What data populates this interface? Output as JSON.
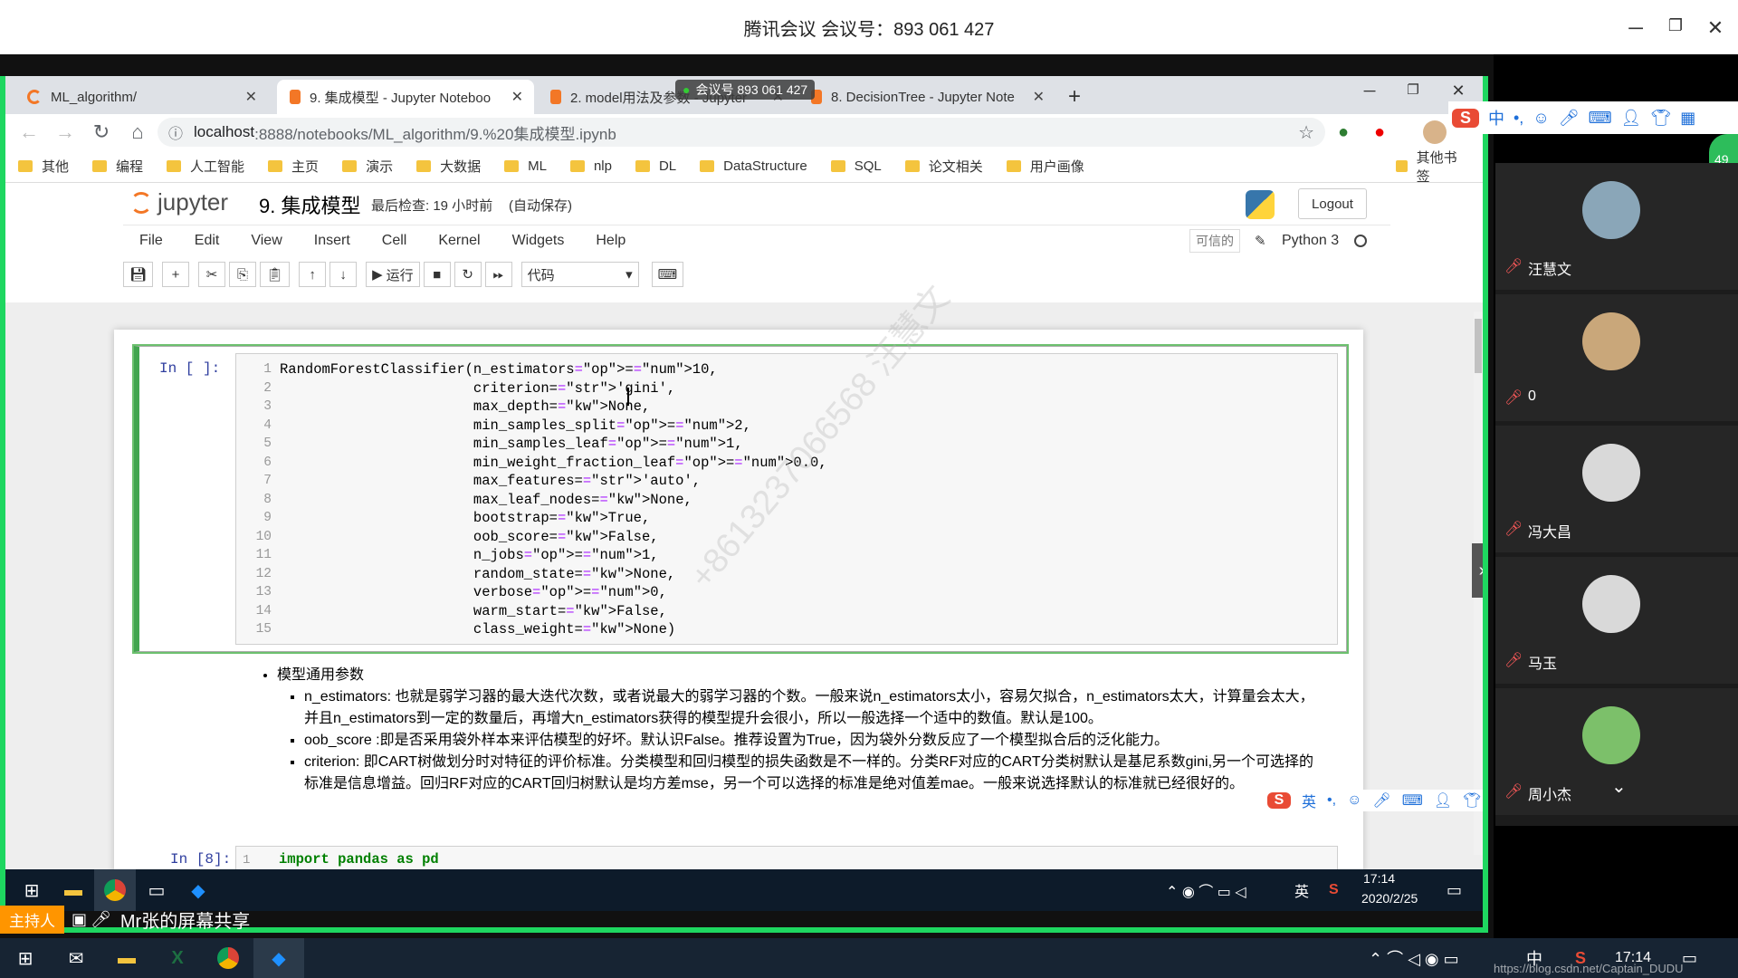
{
  "meeting": {
    "title": "腾讯会议 会议号：893 061 427",
    "float_label": "会议号 893 061 427"
  },
  "browser": {
    "tabs": [
      {
        "label": "ML_algorithm/",
        "active": false
      },
      {
        "label": "9. 集成模型 - Jupyter Noteboo",
        "active": true
      },
      {
        "label": "2. model用法及参数 - Jupyter",
        "active": false
      },
      {
        "label": "8. DecisionTree - Jupyter Note",
        "active": false
      }
    ],
    "url_host": "localhost",
    "url_path": ":8888/notebooks/ML_algorithm/9.%20集成模型.ipynb",
    "bookmarks": [
      "其他",
      "编程",
      "人工智能",
      "主页",
      "演示",
      "大数据",
      "ML",
      "nlp",
      "DL",
      "DataStructure",
      "SQL",
      "论文相关",
      "用户画像"
    ],
    "other_bookmarks": "其他书签"
  },
  "jupyter": {
    "logo_text": "jupyter",
    "notebook_name": "9. 集成模型",
    "checkpoint": "最后检查: 19 小时前",
    "autosave": "(自动保存)",
    "logout": "Logout",
    "menu": [
      "File",
      "Edit",
      "View",
      "Insert",
      "Cell",
      "Kernel",
      "Widgets",
      "Help"
    ],
    "trusted": "可信的",
    "kernel": "Python 3",
    "run_label": "运行",
    "cell_type": "代码"
  },
  "cell": {
    "prompt": "In [ ]:",
    "lines": [
      "RandomForestClassifier(n_estimators=10,",
      "                       criterion='gini',",
      "                       max_depth=None,",
      "                       min_samples_split=2,",
      "                       min_samples_leaf=1,",
      "                       min_weight_fraction_leaf=0.0,",
      "                       max_features='auto',",
      "                       max_leaf_nodes=None,",
      "                       bootstrap=True,",
      "                       oob_score=False,",
      "                       n_jobs=1,",
      "                       random_state=None,",
      "                       verbose=0,",
      "                       warm_start=False,",
      "                       class_weight=None)"
    ]
  },
  "markdown": {
    "heading": "模型通用参数",
    "items": [
      "n_estimators: 也就是弱学习器的最大迭代次数，或者说最大的弱学习器的个数。一般来说n_estimators太小，容易欠拟合，n_estimators太大，计算量会太大，并且n_estimators到一定的数量后，再增大n_estimators获得的模型提升会很小，所以一般选择一个适中的数值。默认是100。",
      "oob_score :即是否采用袋外样本来评估模型的好坏。默认识False。推荐设置为True，因为袋外分数反应了一个模型拟合后的泛化能力。",
      "criterion: 即CART树做划分时对特征的评价标准。分类模型和回归模型的损失函数是不一样的。分类RF对应的CART分类树默认是基尼系数gini,另一个可选择的标准是信息增益。回归RF对应的CART回归树默认是均方差mse，另一个可以选择的标准是绝对值差mae。一般来说选择默认的标准就已经很好的。"
    ]
  },
  "cell2": {
    "prompt": "In [8]:",
    "code": "import pandas as pd"
  },
  "watermark": "+8613237066568 汪慧文",
  "inner_taskbar": {
    "time": "17:14",
    "date": "2020/2/25",
    "lang": "英"
  },
  "host": {
    "role": "主持人",
    "share": "Mr张的屏幕共享"
  },
  "participants": [
    {
      "name": "汪慧文"
    },
    {
      "name": "0"
    },
    {
      "name": "冯大昌"
    },
    {
      "name": "马玉"
    },
    {
      "name": "周小杰"
    }
  ],
  "participants_badge": "49",
  "ime": {
    "chinese": "中",
    "english": "英"
  },
  "outer_taskbar": {
    "time": "17:14",
    "watermark_url": "https://blog.csdn.net/Captain_DUDU"
  }
}
